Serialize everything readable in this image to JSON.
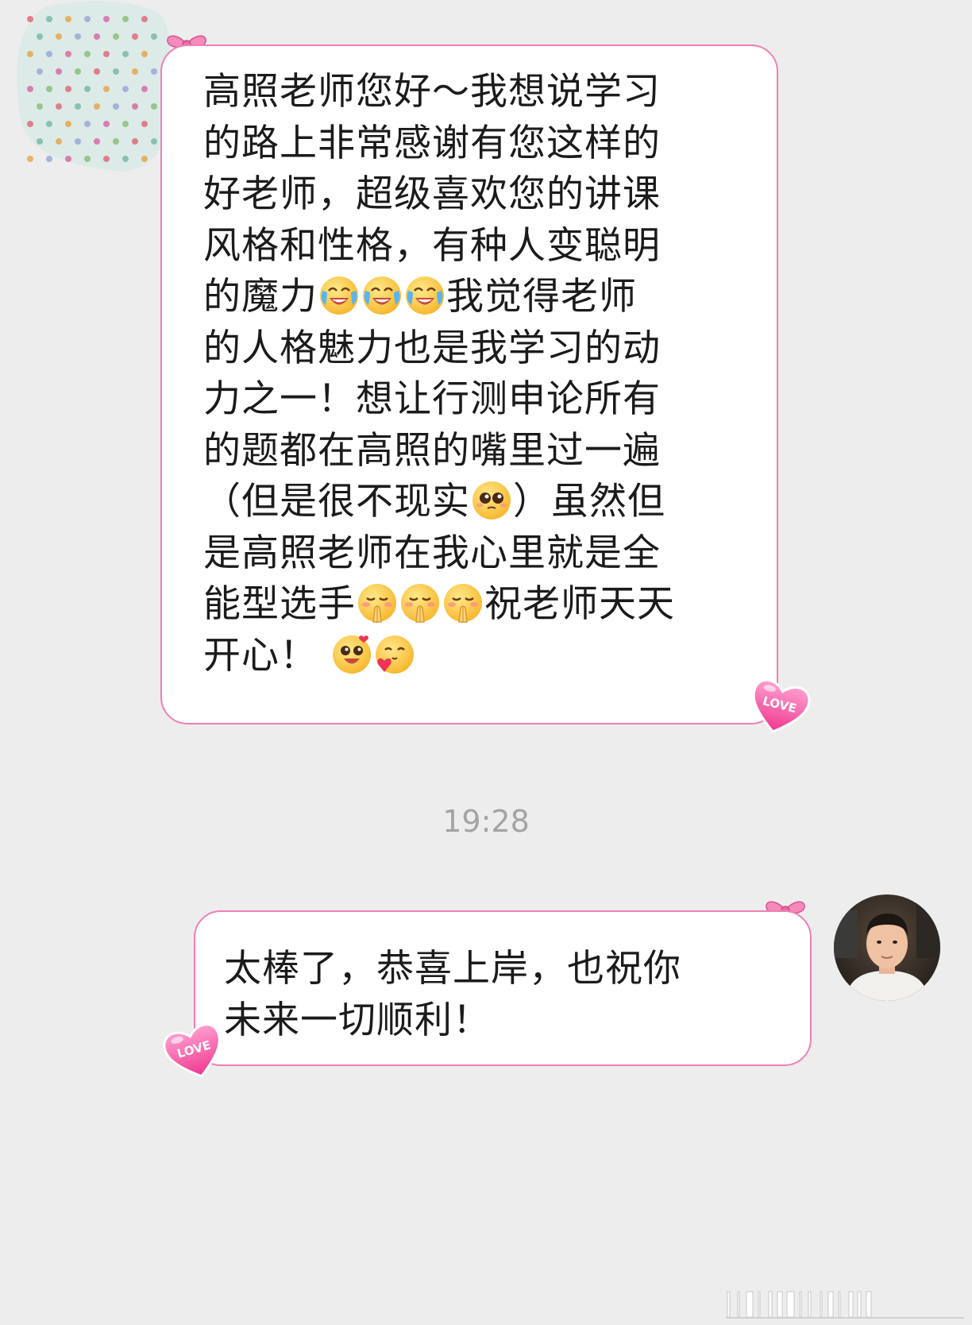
{
  "conversation": {
    "incoming": {
      "lines": [
        [
          {
            "t": "text",
            "v": "高照老师您好～我想说学习"
          }
        ],
        [
          {
            "t": "text",
            "v": "的路上非常感谢有您这样的"
          }
        ],
        [
          {
            "t": "text",
            "v": "好老师，超级喜欢您的讲课"
          }
        ],
        [
          {
            "t": "text",
            "v": "风格和性格，有种人变聪明"
          }
        ],
        [
          {
            "t": "text",
            "v": "的魔力"
          },
          {
            "t": "emoji",
            "v": "crying-laugh"
          },
          {
            "t": "emoji",
            "v": "crying-laugh"
          },
          {
            "t": "emoji",
            "v": "crying-laugh"
          },
          {
            "t": "text",
            "v": "我觉得老师"
          }
        ],
        [
          {
            "t": "text",
            "v": "的人格魅力也是我学习的动"
          }
        ],
        [
          {
            "t": "text",
            "v": "力之一！想让行测申论所有"
          }
        ],
        [
          {
            "t": "text",
            "v": "的题都在高照的嘴里过一遍"
          }
        ],
        [
          {
            "t": "text",
            "v": "（但是很不现实"
          },
          {
            "t": "emoji",
            "v": "pleading"
          },
          {
            "t": "text",
            "v": "）虽然但"
          }
        ],
        [
          {
            "t": "text",
            "v": "是高照老师在我心里就是全"
          }
        ],
        [
          {
            "t": "text",
            "v": "能型选手"
          },
          {
            "t": "emoji",
            "v": "pray"
          },
          {
            "t": "emoji",
            "v": "pray"
          },
          {
            "t": "emoji",
            "v": "pray"
          },
          {
            "t": "text",
            "v": "祝老师天天"
          }
        ],
        [
          {
            "t": "text",
            "v": "开心！ "
          },
          {
            "t": "emoji",
            "v": "love-eyes"
          },
          {
            "t": "emoji",
            "v": "heart-hug"
          }
        ]
      ]
    },
    "timestamp": "19:28",
    "outgoing": {
      "lines": [
        [
          {
            "t": "text",
            "v": "太棒了，恭喜上岸，也祝你"
          }
        ],
        [
          {
            "t": "text",
            "v": "未来一切顺利！"
          }
        ]
      ]
    }
  },
  "stickers": {
    "heart_label": "LOVE"
  },
  "colors": {
    "background": "#ededed",
    "bubble_border": "#f07fb3",
    "timestamp": "#a3a3a3"
  },
  "icons": [
    "polka-dot-avatar",
    "bow-icon",
    "love-heart-icon",
    "user-avatar",
    "watermark-barcode-icon"
  ]
}
